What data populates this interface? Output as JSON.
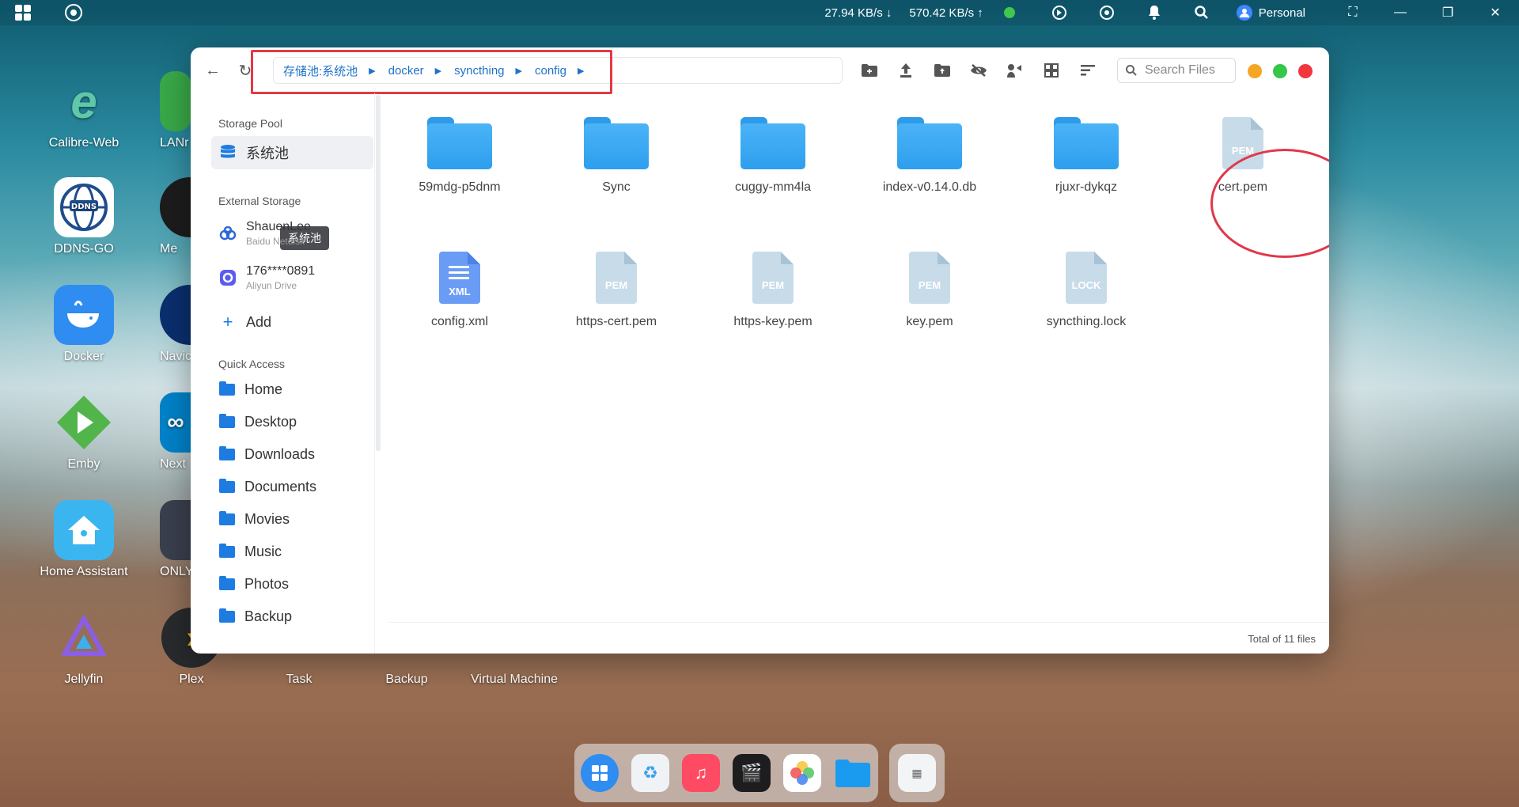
{
  "topbar": {
    "download_speed": "27.94 KB/s",
    "upload_speed": "570.42 KB/s",
    "user_label": "Personal"
  },
  "desktop": {
    "apps": [
      {
        "label": "Calibre-Web",
        "color": "#1a6b7a"
      },
      {
        "label": "LANr"
      },
      {
        "label": "DDNS-GO",
        "color": "#ffffff"
      },
      {
        "label": "Me"
      },
      {
        "label": "Docker",
        "color": "#2f8cf0"
      },
      {
        "label": "Navic"
      },
      {
        "label": "Emby",
        "color": "#52b54b"
      },
      {
        "label": "Next"
      },
      {
        "label": "Home Assistant",
        "color": "#3bb5f0"
      },
      {
        "label": "ONLYO"
      },
      {
        "label": "Jellyfin",
        "color": "#7a5ce8"
      },
      {
        "label": "Plex",
        "color": "#e5a00d"
      },
      {
        "label": "Task"
      },
      {
        "label": "Backup"
      },
      {
        "label": "Virtual Machine"
      }
    ]
  },
  "window": {
    "breadcrumb": [
      "存储池:系统池",
      "docker",
      "syncthing",
      "config"
    ],
    "search_placeholder": "Search Files",
    "light_colors": [
      "#f5a623",
      "#34c749",
      "#f0373d"
    ]
  },
  "sidebar": {
    "storage_pool_heading": "Storage Pool",
    "pool_item": "系统池",
    "tooltip": "系统池",
    "external_heading": "External Storage",
    "external": [
      {
        "name": "ShauenLee",
        "sub": "Baidu Netdisk"
      },
      {
        "name": "176****0891",
        "sub": "Aliyun Drive"
      }
    ],
    "add_label": "Add",
    "quick_heading": "Quick Access",
    "quick": [
      "Home",
      "Desktop",
      "Downloads",
      "Documents",
      "Movies",
      "Music",
      "Photos",
      "Backup"
    ]
  },
  "files": [
    {
      "name": "59mdg-p5dnm",
      "kind": "folder"
    },
    {
      "name": "Sync",
      "kind": "folder"
    },
    {
      "name": "cuggy-mm4la",
      "kind": "folder"
    },
    {
      "name": "index-v0.14.0.db",
      "kind": "folder"
    },
    {
      "name": "rjuxr-dykqz",
      "kind": "folder"
    },
    {
      "name": "cert.pem",
      "kind": "file",
      "tag": "PEM"
    },
    {
      "name": "config.xml",
      "kind": "file",
      "tag": "XML"
    },
    {
      "name": "https-cert.pem",
      "kind": "file",
      "tag": "PEM"
    },
    {
      "name": "https-key.pem",
      "kind": "file",
      "tag": "PEM"
    },
    {
      "name": "key.pem",
      "kind": "file",
      "tag": "PEM"
    },
    {
      "name": "syncthing.lock",
      "kind": "file",
      "tag": "LOCK"
    }
  ],
  "footer": {
    "total": "Total of 11 files"
  }
}
